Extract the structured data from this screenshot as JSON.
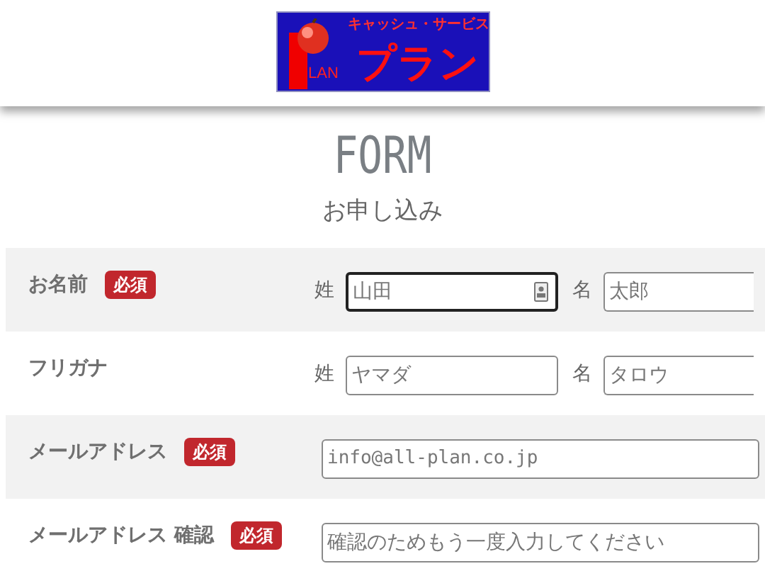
{
  "logo": {
    "tagline": "キャッシュ・サービス",
    "small": "LAN",
    "name": "プラン"
  },
  "title": "FORM",
  "subtitle": "お申し込み",
  "rows": [
    {
      "kind": "pair",
      "label": "お名前",
      "required": true,
      "badge": "必須",
      "fields": [
        {
          "prefix": "姓",
          "placeholder": "山田",
          "focused": true
        },
        {
          "prefix": "名",
          "placeholder": "太郎",
          "focused": false
        }
      ]
    },
    {
      "kind": "pair",
      "label": "フリガナ",
      "required": false,
      "fields": [
        {
          "prefix": "姓",
          "placeholder": "ヤマダ",
          "focused": false
        },
        {
          "prefix": "名",
          "placeholder": "タロウ",
          "focused": false
        }
      ]
    },
    {
      "kind": "single",
      "label": "メールアドレス",
      "required": true,
      "badge": "必須",
      "fields": [
        {
          "placeholder": "info@all-plan.co.jp",
          "mono": true,
          "focused": false
        }
      ]
    },
    {
      "kind": "single",
      "label": "メールアドレス 確認",
      "required": true,
      "badge": "必須",
      "fields": [
        {
          "placeholder": "確認のためもう一度入力してください",
          "mono": false,
          "focused": false
        }
      ]
    }
  ]
}
